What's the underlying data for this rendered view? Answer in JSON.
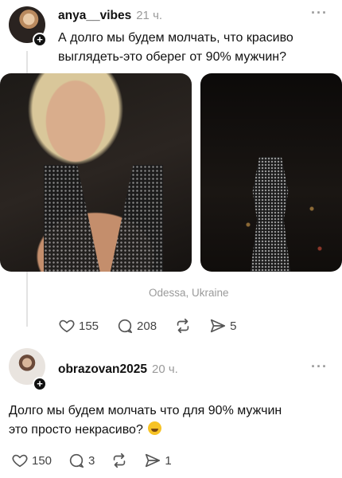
{
  "post": {
    "username": "anya__vibes",
    "time": "21 ч.",
    "more": "···",
    "text": "А долго мы будем молчать, что красиво выглядеть-это оберег от 90% мужчин?",
    "location": "Odessa, Ukraine",
    "likes": "155",
    "comments": "208",
    "shares": "5"
  },
  "reply": {
    "username": "obrazovan2025",
    "time": "20 ч.",
    "more": "···",
    "text": "Долго мы будем молчать что для 90% мужчин это просто некрасиво?",
    "likes": "150",
    "comments": "3",
    "shares": "1"
  },
  "icons": [
    "heart-icon",
    "comment-icon",
    "repost-icon",
    "share-icon",
    "plus-icon",
    "more-icon"
  ],
  "colors": {
    "text": "#111111",
    "muted": "#9a9a9a",
    "icon": "#555555",
    "thread_line": "#e3e3e3"
  }
}
